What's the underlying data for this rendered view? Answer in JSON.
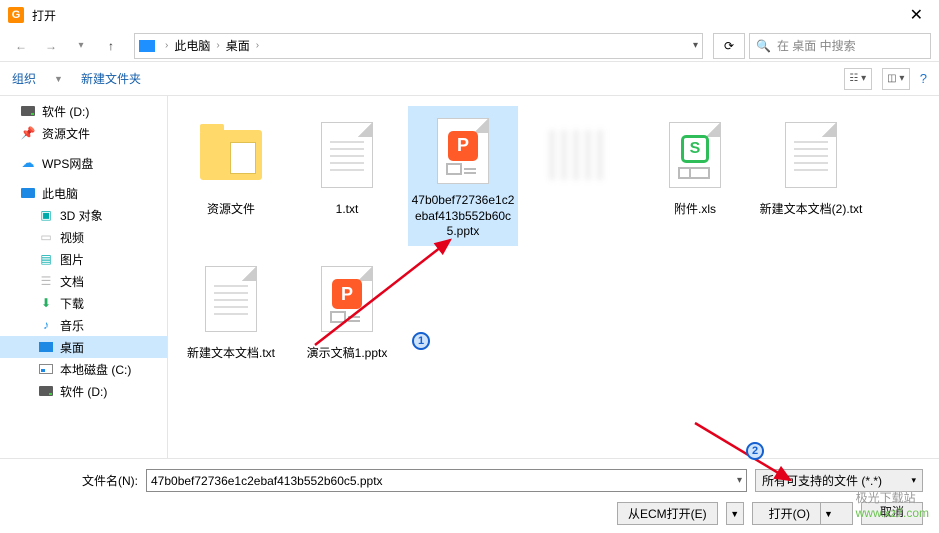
{
  "title": "打开",
  "breadcrumb": {
    "root": "此电脑",
    "current": "桌面"
  },
  "search": {
    "placeholder": "在 桌面 中搜索"
  },
  "toolbar": {
    "organize": "组织",
    "new_folder": "新建文件夹"
  },
  "sidebar": {
    "items": [
      {
        "label": "软件 (D:)",
        "icon": "drive"
      },
      {
        "label": "资源文件",
        "icon": "pin"
      },
      {
        "label": "WPS网盘",
        "icon": "cloud",
        "gap": true
      },
      {
        "label": "此电脑",
        "icon": "pc",
        "gap": true
      },
      {
        "label": "3D 对象",
        "icon": "3d",
        "child": true
      },
      {
        "label": "视频",
        "icon": "video",
        "child": true
      },
      {
        "label": "图片",
        "icon": "picture",
        "child": true
      },
      {
        "label": "文档",
        "icon": "doc",
        "child": true
      },
      {
        "label": "下载",
        "icon": "download",
        "child": true
      },
      {
        "label": "音乐",
        "icon": "music",
        "child": true
      },
      {
        "label": "桌面",
        "icon": "desktop",
        "child": true,
        "selected": true
      },
      {
        "label": "本地磁盘 (C:)",
        "icon": "localc",
        "child": true
      },
      {
        "label": "软件 (D:)",
        "icon": "drive",
        "child": true
      }
    ]
  },
  "files": [
    {
      "label": "资源文件",
      "type": "folder"
    },
    {
      "label": "1.txt",
      "type": "txt"
    },
    {
      "label": "47b0bef72736e1c2ebaf413b552b60c5.pptx",
      "type": "pptx",
      "selected": true
    },
    {
      "label": "",
      "type": "blur"
    },
    {
      "label": "附件.xls",
      "type": "xls"
    },
    {
      "label": "新建文本文档(2).txt",
      "type": "txt"
    },
    {
      "label": "新建文本文档.txt",
      "type": "txt"
    },
    {
      "label": "演示文稿1.pptx",
      "type": "pptx"
    }
  ],
  "bottom": {
    "filename_label": "文件名(N):",
    "filename_value": "47b0bef72736e1c2ebaf413b552b60c5.pptx",
    "filetype_value": "所有可支持的文件 (*.*)",
    "ecm_label": "从ECM打开(E)",
    "open_label": "打开(O)",
    "cancel_label": "取消"
  },
  "annotations": {
    "one": "1",
    "two": "2"
  },
  "watermark": {
    "cn": "极光下载站",
    "url": "www.xz7.com"
  }
}
